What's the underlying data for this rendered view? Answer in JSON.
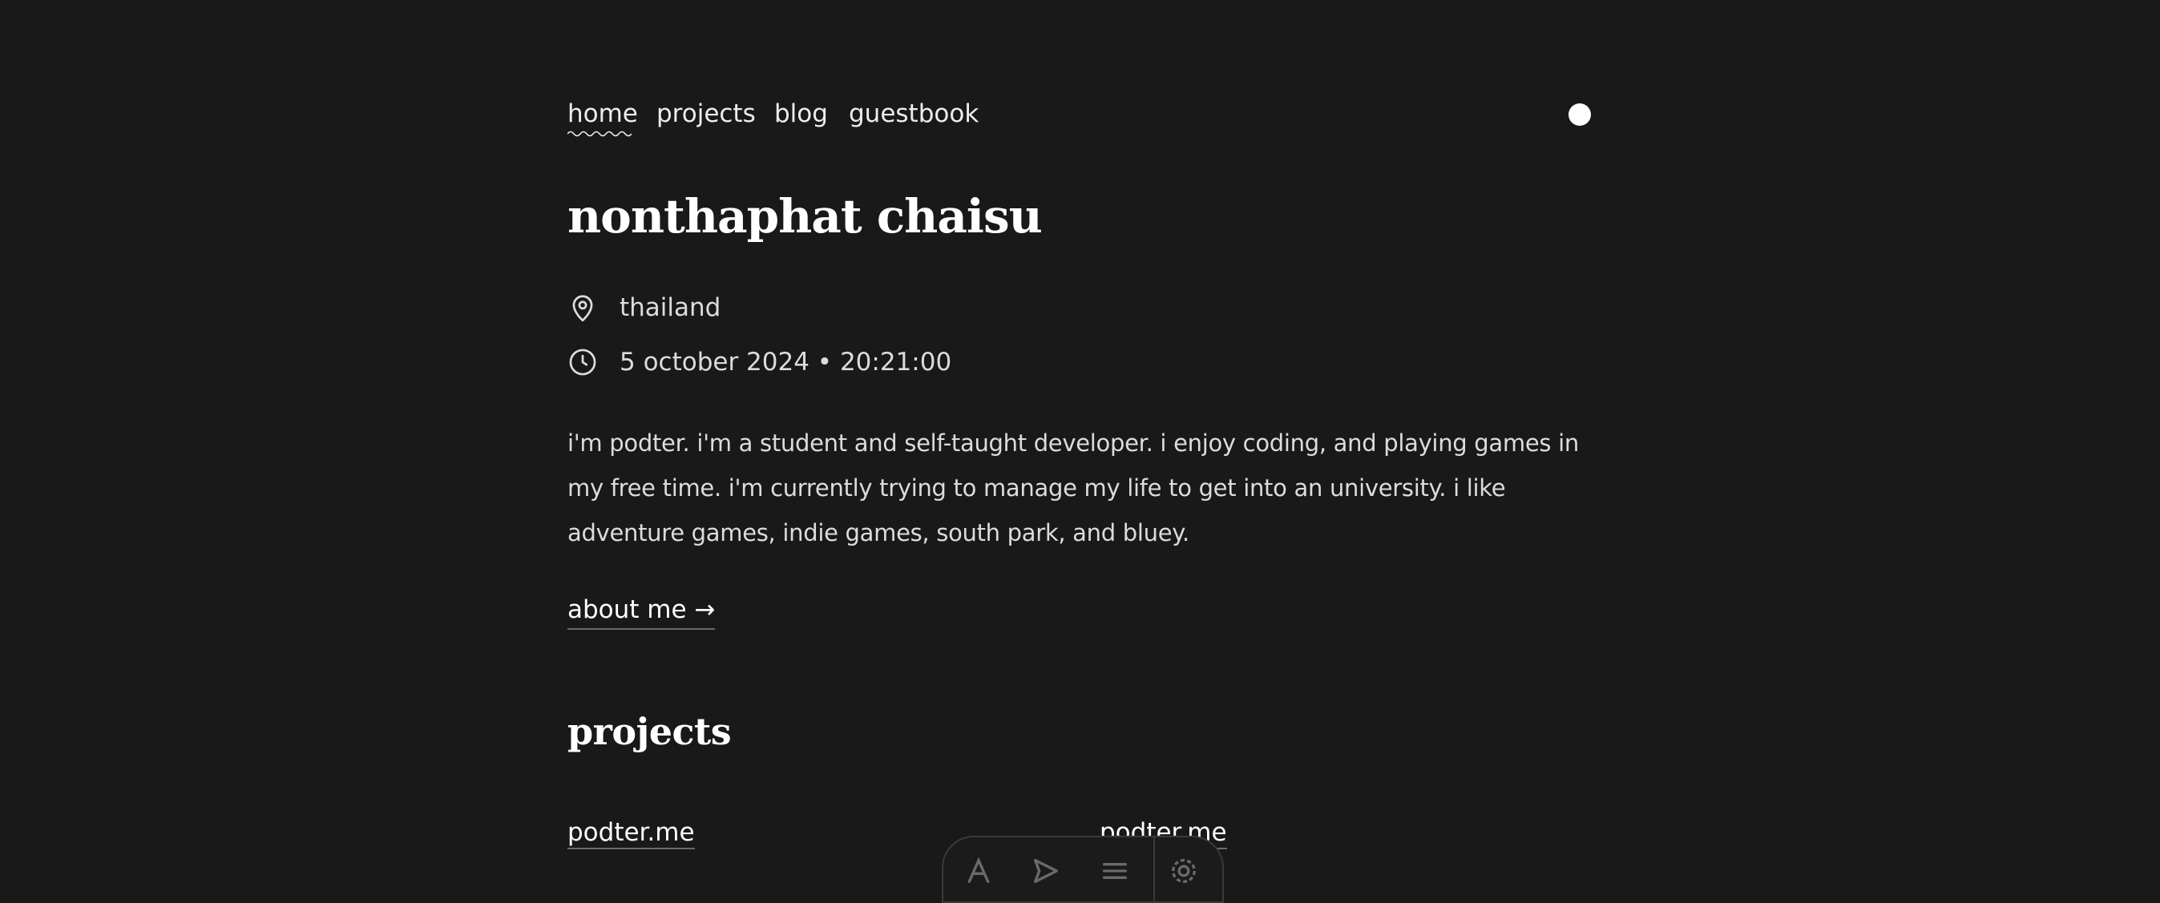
{
  "nav": {
    "items": [
      {
        "label": "home"
      },
      {
        "label": "projects"
      },
      {
        "label": "blog"
      },
      {
        "label": "guestbook"
      }
    ],
    "active": "home",
    "theme_toggle_icon": "theme-toggle-dot-icon"
  },
  "profile": {
    "name": "nonthaphat chaisu",
    "location": "thailand",
    "location_icon": "map-pin-icon",
    "datetime": "5 october 2024 • 20:21:00",
    "clock_icon": "clock-icon",
    "bio": "i'm podter. i'm a student and self-taught developer. i enjoy coding, and playing games in my free time. i'm currently trying to manage my life to get into an university. i like adventure games, indie games, south park, and bluey.",
    "about_link": "about me →"
  },
  "projects": {
    "title": "projects",
    "items": [
      {
        "label": "podter.me"
      },
      {
        "label": "podter.me"
      }
    ]
  },
  "dock": {
    "icons": [
      "text-icon",
      "send-icon",
      "menu-icon",
      "settings-icon"
    ]
  },
  "colors": {
    "background": "#191919",
    "text": "#ededed",
    "muted_underline": "#6a6a6a"
  }
}
